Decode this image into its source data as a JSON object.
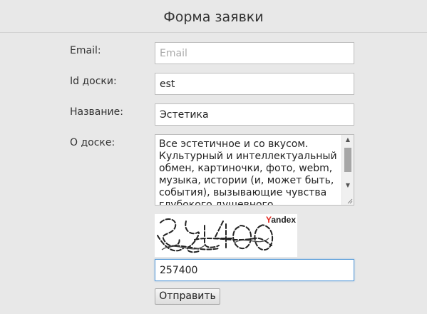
{
  "form": {
    "title": "Форма заявки",
    "email": {
      "label": "Email:",
      "placeholder": "Email",
      "value": ""
    },
    "board_id": {
      "label": "Id доски:",
      "value": "est"
    },
    "name": {
      "label": "Название:",
      "value": "Эстетика"
    },
    "about": {
      "label": "О доске:",
      "value": "Все эстетичное и со вкусом. Культурный и интеллектуальный обмен, картиночки, фото, webm, музыка, истории (и, может быть, события), вызывающие чувства глубокого душевного"
    },
    "captcha": {
      "brand": "Yandex",
      "brand_first_letter": "Y",
      "brand_rest": "andex",
      "answer": "257400"
    },
    "submit_label": "Отправить"
  },
  "icons": {
    "scroll_up": "scroll-up-arrow-icon",
    "scroll_down": "scroll-down-arrow-icon",
    "resize": "resize-grip-icon"
  },
  "colors": {
    "background": "#e8e8e8",
    "focus_border": "#5b9dd9",
    "yandex_red": "#e2231a"
  }
}
